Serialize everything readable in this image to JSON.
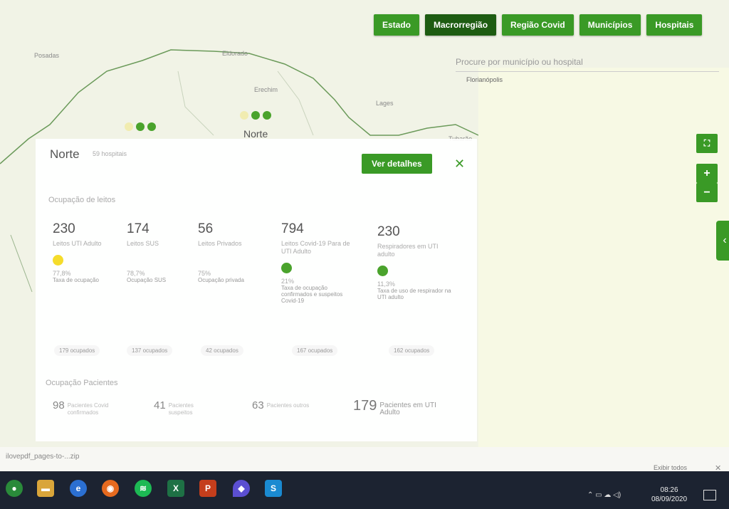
{
  "nav": {
    "buttons": [
      "Estado",
      "Macrorregião",
      "Região Covid",
      "Municípios",
      "Hospitais"
    ],
    "active": "Macrorregião"
  },
  "search": {
    "placeholder": "Procure por município ou hospital"
  },
  "map": {
    "labels": [
      "Posadas",
      "Eldorado",
      "Erechim",
      "Lages",
      "Florianópolis",
      "Tubarão",
      "Norte"
    ]
  },
  "panel": {
    "title": "Norte",
    "subtitle": "59 hospitais",
    "ver_detalhes": "Ver detalhes",
    "occupancy_heading": "Ocupação de leitos",
    "stats": [
      {
        "num": "230",
        "label": "Leitos UTI Adulto",
        "pct": "77,8%",
        "plabel": "Taxa de ocupação",
        "dot": "#f5dc2b"
      },
      {
        "num": "174",
        "label": "Leitos SUS",
        "pct": "78,7%",
        "plabel": "Ocupação SUS",
        "dot": ""
      },
      {
        "num": "56",
        "label": "Leitos Privados",
        "pct": "75%",
        "plabel": "Ocupação privada",
        "dot": ""
      },
      {
        "num": "794",
        "label": "Leitos Covid-19 Para de UTI Adulto",
        "pct": "21%",
        "plabel": "Taxa de ocupação confirmados e suspeitos Covid-19",
        "dot": "#4aa32c"
      },
      {
        "num": "230",
        "label": "Respiradores em UTI adulto",
        "pct": "11,3%",
        "plabel": "Taxa de uso de respirador na UTI adulto",
        "dot": "#4aa32c"
      }
    ],
    "occupied": [
      "179 ocupados",
      "137 ocupados",
      "42 ocupados",
      "167 ocupados",
      "162 ocupados"
    ],
    "patients_heading": "Ocupação Pacientes",
    "patients": [
      {
        "n": "98",
        "label": "Pacientes Covid confirmados"
      },
      {
        "n": "41",
        "label": "Pacientes suspeitos"
      },
      {
        "n": "63",
        "label": "Pacientes outros"
      },
      {
        "n": "179",
        "label": "Pacientes em UTI Adulto"
      }
    ]
  },
  "downloads": {
    "item": "ilovepdf_pages-to-...zip",
    "show_all": "Exibir todos"
  },
  "taskbar": {
    "time": "08:26",
    "date": "08/09/2020"
  },
  "colors": {
    "primary": "#3a9a26",
    "active": "#1e5c12",
    "yellow": "#f5dc2b"
  }
}
